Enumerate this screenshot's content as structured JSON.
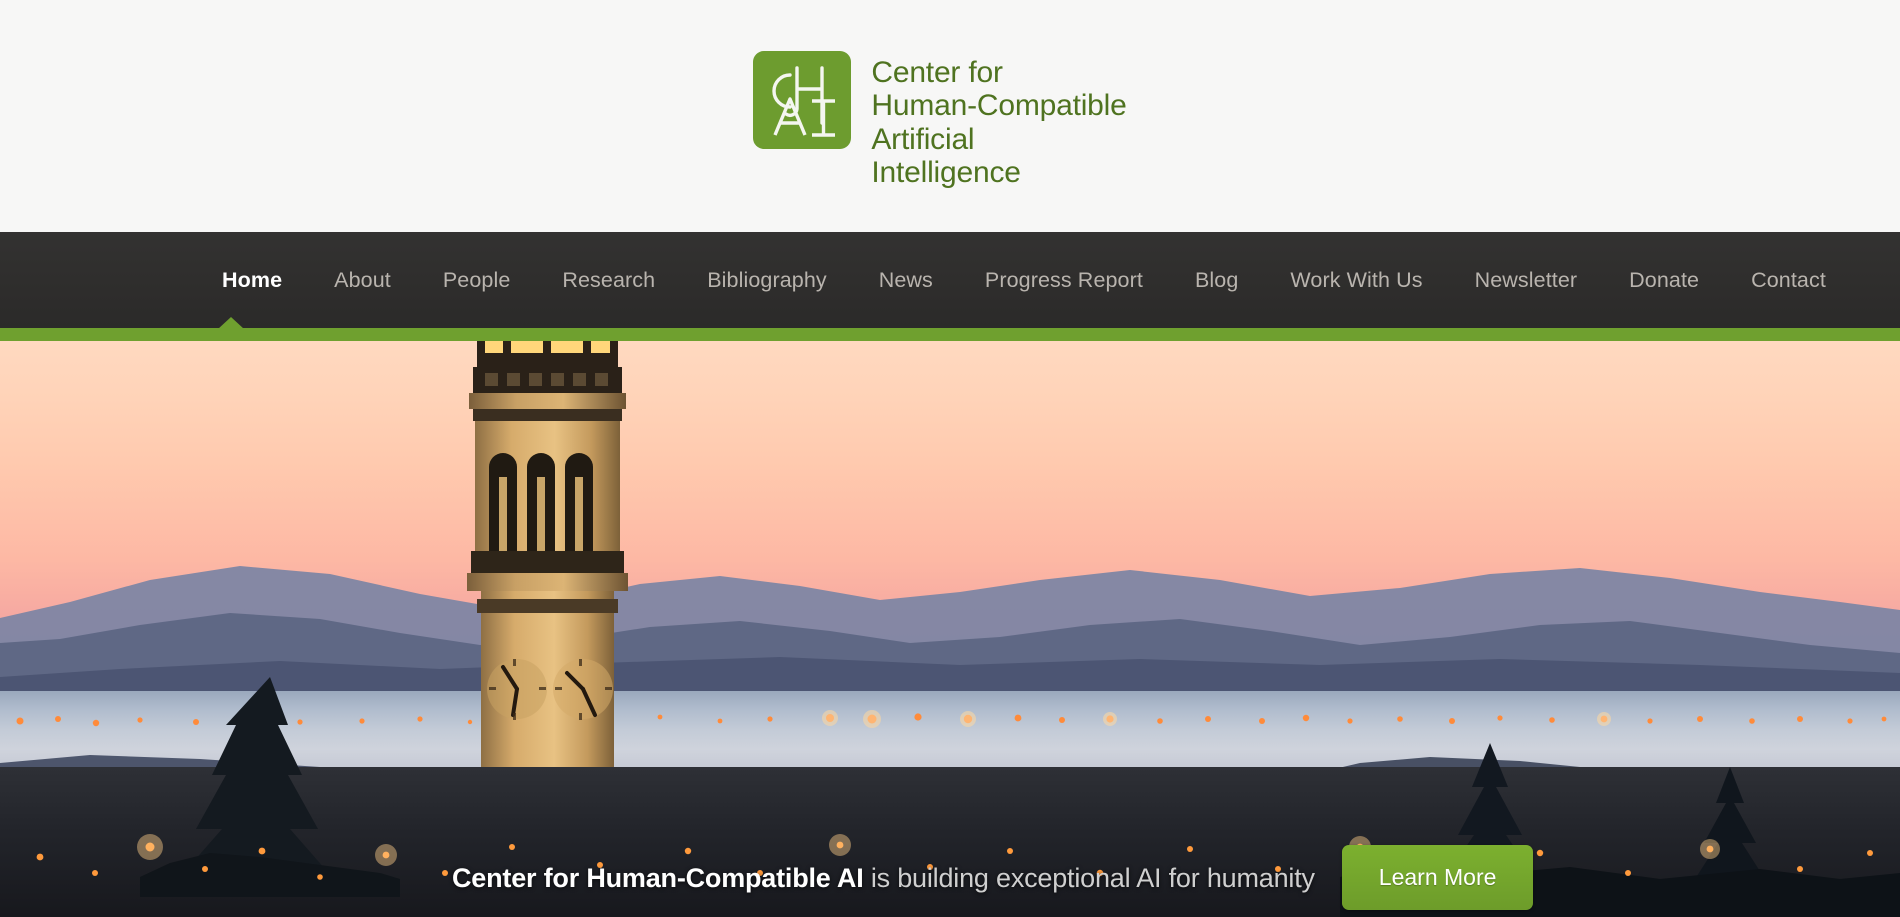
{
  "header": {
    "logo_icon": "chai-logo-icon",
    "logo_letters_top": "CH",
    "logo_letters_bottom": "AI",
    "title_lines": [
      "Center for",
      "Human-Compatible",
      "Artificial",
      "Intelligence"
    ],
    "brand_green": "#6d9c2f",
    "title_green": "#4f7320",
    "background": "#f7f7f6"
  },
  "nav": {
    "background": "#2f2e2d",
    "accent_bar_color": "#6fa02f",
    "active_index": 0,
    "items": [
      {
        "label": "Home",
        "active": true
      },
      {
        "label": "About",
        "active": false
      },
      {
        "label": "People",
        "active": false
      },
      {
        "label": "Research",
        "active": false
      },
      {
        "label": "Bibliography",
        "active": false
      },
      {
        "label": "News",
        "active": false
      },
      {
        "label": "Progress Report",
        "active": false
      },
      {
        "label": "Blog",
        "active": false
      },
      {
        "label": "Work With Us",
        "active": false
      },
      {
        "label": "Newsletter",
        "active": false
      },
      {
        "label": "Donate",
        "active": false
      },
      {
        "label": "Contact",
        "active": false
      }
    ]
  },
  "hero": {
    "image_description": "Sather Tower (Campanile) at UC Berkeley silhouetted against a sunset sky over San Francisco Bay",
    "caption_bold": "Center for Human-Compatible AI",
    "caption_rest": " is building exceptional AI for humanity",
    "cta_label": "Learn More",
    "cta_color": "#73a62c",
    "sky_top_color": "#ffd9c0",
    "sky_bottom_color": "#c884a2"
  }
}
